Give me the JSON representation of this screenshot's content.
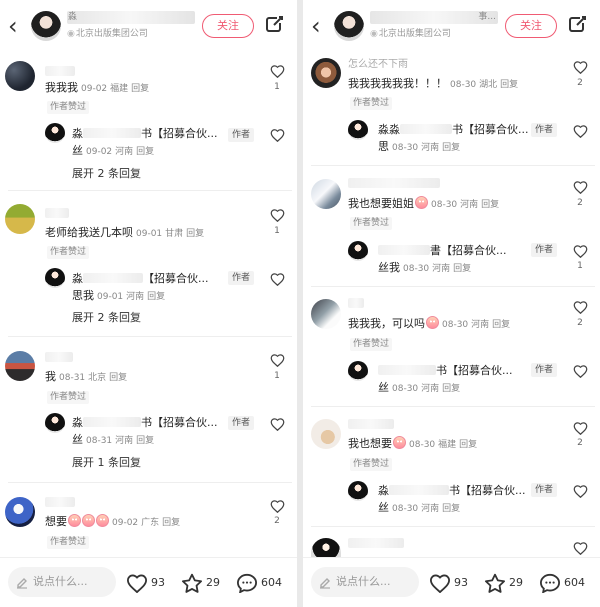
{
  "left": {
    "top": {
      "name_partial": "淼",
      "org": "北京出版集团公司",
      "follow": "关注"
    },
    "comments": [
      {
        "text": "我我我",
        "date": "09-02",
        "loc": "福建",
        "reply": "回复",
        "badge": "作者赞过",
        "likes": "1",
        "author_reply": {
          "name": "淼",
          "tail": "书【招募合伙...",
          "role": "作者",
          "text": "丝",
          "date": "09-02",
          "loc": "河南",
          "reply": "回复"
        },
        "expand": "展开 2 条回复"
      },
      {
        "text": "老师给我送几本呗",
        "date": "09-01",
        "loc": "甘肃",
        "reply": "回复",
        "badge": "作者赞过",
        "likes": "1",
        "author_reply": {
          "name": "淼",
          "tail": "【招募合伙...",
          "role": "作者",
          "text": "思我",
          "date": "09-01",
          "loc": "河南",
          "reply": "回复"
        },
        "expand": "展开 2 条回复"
      },
      {
        "text": "我",
        "date": "08-31",
        "loc": "北京",
        "reply": "回复",
        "badge": "作者赞过",
        "likes": "1",
        "author_reply": {
          "name": "淼",
          "tail": "书【招募合伙...",
          "role": "作者",
          "text": "丝",
          "date": "08-31",
          "loc": "河南",
          "reply": "回复"
        },
        "expand": "展开 1 条回复"
      },
      {
        "text": "想要",
        "date": "09-02",
        "loc": "广东",
        "reply": "回复",
        "badge": "作者赞过",
        "likes": "2"
      }
    ],
    "bottom": {
      "placeholder": "说点什么...",
      "likes": "93",
      "stars": "29",
      "comments": "604"
    }
  },
  "right": {
    "top": {
      "name_tail": "事...",
      "org": "北京出版集团公司",
      "follow": "关注"
    },
    "comments": [
      {
        "prev": "怎么还不下雨",
        "text": "我我我我我我！！！",
        "date": "08-30",
        "loc": "湖北",
        "reply": "回复",
        "badge": "作者赞过",
        "likes": "2",
        "author_reply": {
          "name": "淼淼",
          "tail": "书【招募合伙...",
          "role": "作者",
          "text": "思",
          "date": "08-30",
          "loc": "河南",
          "reply": "回复"
        }
      },
      {
        "text": "我也想要姐姐",
        "date": "08-30",
        "loc": "河南",
        "reply": "回复",
        "badge": "作者赞过",
        "likes": "2",
        "author_reply": {
          "name": "",
          "tail": "書【招募合伙...",
          "role": "作者",
          "text": "丝我",
          "date": "08-30",
          "loc": "河南",
          "reply": "回复",
          "likes": "1"
        }
      },
      {
        "text": "我我我，可以吗",
        "date": "08-30",
        "loc": "河南",
        "reply": "回复",
        "badge": "作者赞过",
        "likes": "2",
        "author_reply": {
          "name": "",
          "tail": "书【招募合伙...",
          "role": "作者",
          "text": "丝",
          "date": "08-30",
          "loc": "河南",
          "reply": "回复"
        }
      },
      {
        "text": "我也想要",
        "date": "08-30",
        "loc": "福建",
        "reply": "回复",
        "badge": "作者赞过",
        "likes": "2",
        "author_reply": {
          "name": "淼",
          "tail": "书【招募合伙...",
          "role": "作者",
          "text": "丝",
          "date": "08-30",
          "loc": "河南",
          "reply": "回复"
        }
      }
    ],
    "bottom": {
      "placeholder": "说点什么...",
      "likes": "93",
      "stars": "29",
      "comments": "604"
    }
  }
}
